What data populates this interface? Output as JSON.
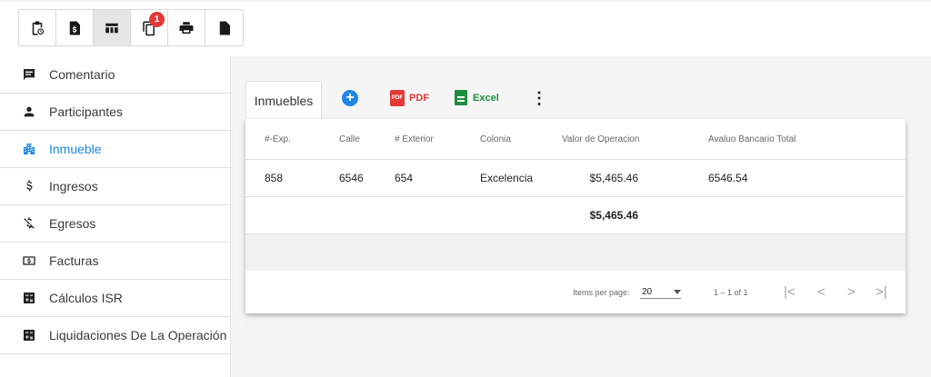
{
  "toolbar": {
    "buttons": [
      {
        "icon": "clipboard-clock-icon"
      },
      {
        "icon": "invoice-dollar-icon"
      },
      {
        "icon": "table-icon",
        "active": true
      },
      {
        "icon": "copy-icon",
        "badge": "1"
      },
      {
        "icon": "print-icon"
      },
      {
        "icon": "document-icon"
      }
    ]
  },
  "sidebar": {
    "items": [
      {
        "label": "Comentario",
        "icon": "comment-icon"
      },
      {
        "label": "Participantes",
        "icon": "person-icon"
      },
      {
        "label": "Inmueble",
        "icon": "building-icon",
        "active": true
      },
      {
        "label": "Ingresos",
        "icon": "dollar-icon"
      },
      {
        "label": "Egresos",
        "icon": "dollar-off-icon"
      },
      {
        "label": "Facturas",
        "icon": "bill-icon"
      },
      {
        "label": "Cálculos ISR",
        "icon": "calculator-icon"
      },
      {
        "label": "Liquidaciones De La Operación",
        "icon": "calculator-icon"
      }
    ]
  },
  "main": {
    "tab_label": "Inmuebles",
    "actions": {
      "pdf_label": "PDF",
      "pdf_icon_text": "PDF",
      "excel_label": "Excel",
      "add_symbol": "+",
      "more_symbol": "⋮"
    },
    "table": {
      "headers": [
        "#-Exp.",
        "Calle",
        "# Exterior",
        "Colonia",
        "Valor de Operacion",
        "Avaluo Bancario Total"
      ],
      "rows": [
        [
          "858",
          "6546",
          "654",
          "Excelencia",
          "$5,465.46",
          "6546.54"
        ]
      ],
      "total_value": "$5,465.46"
    },
    "paginator": {
      "items_per_page_label": "Items per page:",
      "page_size": "20",
      "range_label": "1 – 1 of 1",
      "first": "|<",
      "prev": "<",
      "next": ">",
      "last": ">|"
    }
  },
  "colors": {
    "accent": "#1e88e5",
    "pdf": "#e53935",
    "excel": "#1e8e3e",
    "badge": "#e53935"
  }
}
